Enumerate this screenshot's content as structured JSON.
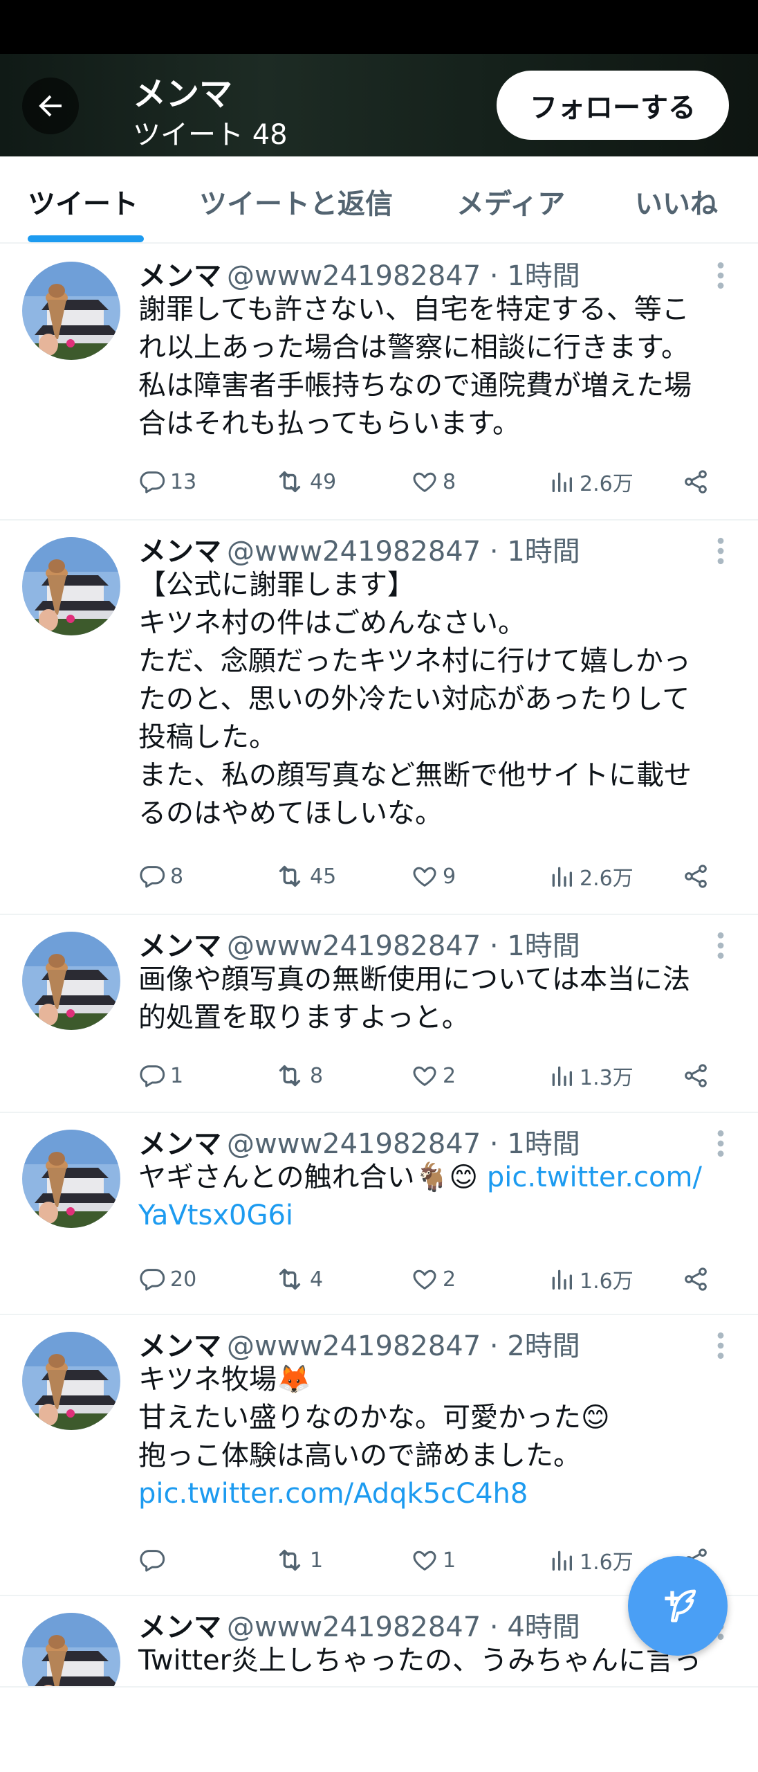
{
  "header": {
    "name": "メンマ",
    "tweet_count": "ツイート 48",
    "follow_label": "フォローする"
  },
  "tabs": [
    "ツイート",
    "ツイートと返信",
    "メディア",
    "いいね"
  ],
  "tweets": [
    {
      "name": "メンマ",
      "handle": "@www241982847",
      "time": "· 1時間",
      "text": "謝罪しても許さない、自宅を特定する、等こ\nれ以上あった場合は警察に相談に行きます。\n私は障害者手帳持ちなので通院費が増えた場\n合はそれも払ってもらいます。",
      "link": "",
      "replies": "13",
      "retweets": "49",
      "likes": "8",
      "views": "2.6万"
    },
    {
      "name": "メンマ",
      "handle": "@www241982847",
      "time": "· 1時間",
      "text": "【公式に謝罪します】\nキツネ村の件はごめんなさい。\nただ、念願だったキツネ村に行けて嬉しかっ\nたのと、思いの外冷たい対応があったりして\n投稿した。\nまた、私の顔写真など無断で他サイトに載せ\nるのはやめてほしいな。",
      "link": "",
      "replies": "8",
      "retweets": "45",
      "likes": "9",
      "views": "2.6万"
    },
    {
      "name": "メンマ",
      "handle": "@www241982847",
      "time": "· 1時間",
      "text": "画像や顔写真の無断使用については本当に法\n的処置を取りますよっと。",
      "link": "",
      "replies": "1",
      "retweets": "8",
      "likes": "2",
      "views": "1.3万"
    },
    {
      "name": "メンマ",
      "handle": "@www241982847",
      "time": "· 1時間",
      "text": "ヤギさんとの触れ合い🐐😊 ",
      "link": "pic.twitter.com/\nYaVtsx0G6i",
      "replies": "20",
      "retweets": "4",
      "likes": "2",
      "views": "1.6万"
    },
    {
      "name": "メンマ",
      "handle": "@www241982847",
      "time": "· 2時間",
      "text": "キツネ牧場🦊\n甘えたい盛りなのかな。可愛かった😊\n抱っこ体験は高いので諦めました。\n",
      "link": "pic.twitter.com/Adqk5cC4h8",
      "replies": "",
      "retweets": "1",
      "likes": "1",
      "views": "1.6万"
    },
    {
      "name": "メンマ",
      "handle": "@www241982847",
      "time": "· 4時間",
      "text": "Twitter炎上しちゃったの、うみちゃんに言っ",
      "link": ""
    }
  ],
  "icons": {
    "back": "back-arrow-icon",
    "reply": "reply-icon",
    "retweet": "retweet-icon",
    "like": "heart-icon",
    "views": "views-icon",
    "share": "share-icon",
    "compose": "compose-icon",
    "more": "more-icon"
  },
  "colors": {
    "accent": "#1d9bf0",
    "secondary_text": "#536471",
    "primary_text": "#0f1419"
  }
}
